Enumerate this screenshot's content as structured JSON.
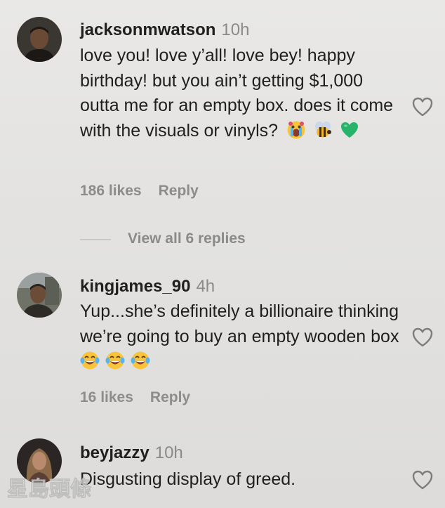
{
  "comments": [
    {
      "username": "jacksonmwatson",
      "time": "10h",
      "text": "love you! love y’all! love bey! happy birthday! but you ain’t getting $1,000 outta me for an empty box. does it come with the visuals or vinyls?",
      "emojis": [
        "crying-face-emoji",
        "bee-emoji",
        "green-heart-emoji"
      ],
      "likes": "186 likes",
      "reply": "Reply",
      "view_replies": "View all 6 replies"
    },
    {
      "username": "kingjames_90",
      "time": "4h",
      "text": "Yup...she’s definitely a billionaire thinking we’re going to buy an empty wooden box",
      "emojis": [
        "tears-of-joy-emoji",
        "tears-of-joy-emoji",
        "tears-of-joy-emoji"
      ],
      "likes": "16 likes",
      "reply": "Reply"
    },
    {
      "username": "beyjazzy",
      "time": "10h",
      "text": "Disgusting display of greed."
    }
  ],
  "icons": {
    "like": "heart-outline-icon"
  },
  "colors": {
    "background": "#e4e3e1",
    "text": "#1f1f1f",
    "secondary": "#8a8a8a"
  },
  "watermark": "星島頭條"
}
